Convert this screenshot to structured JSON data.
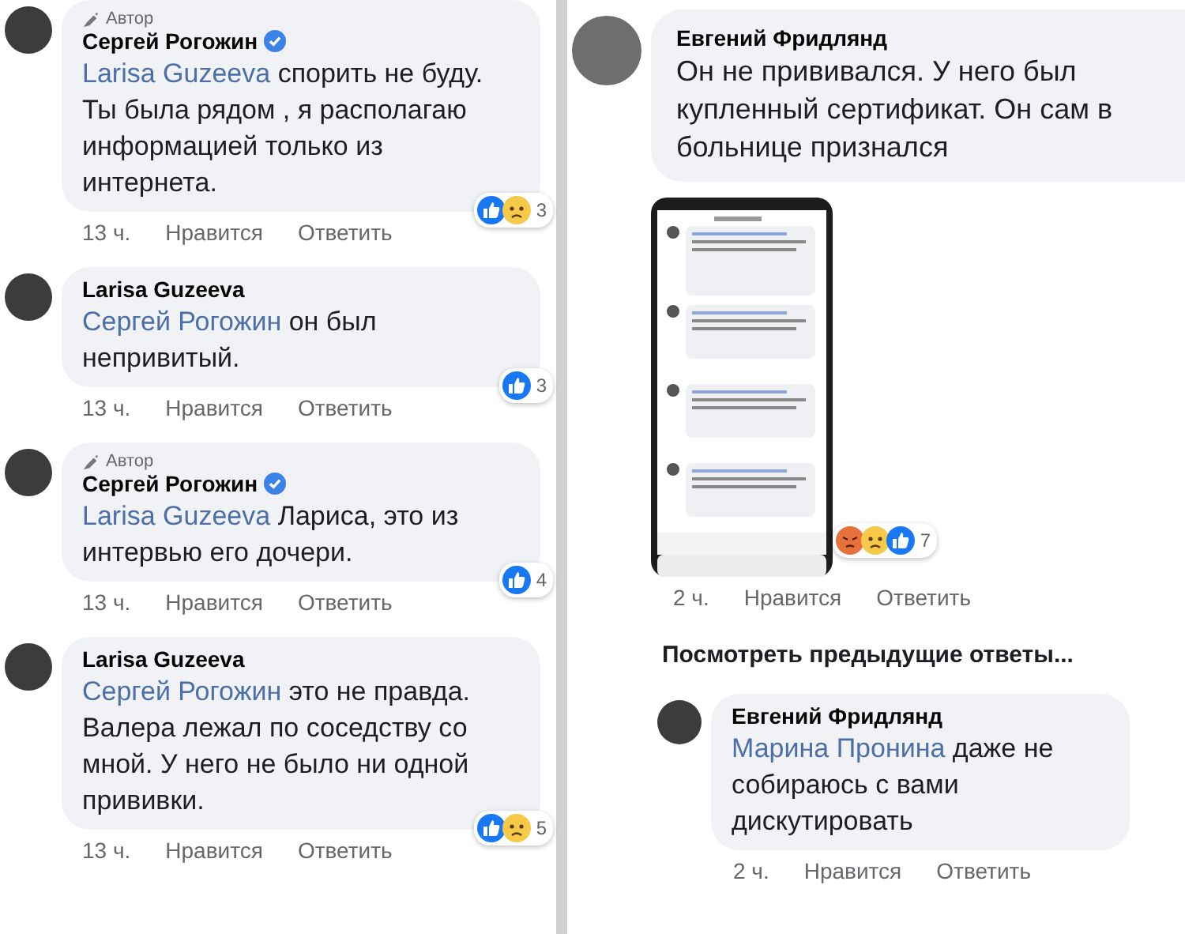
{
  "left_column": {
    "comments": [
      {
        "author_badge": "Автор",
        "name": "Сергей Рогожин",
        "verified": true,
        "mention": "Larisa Guzeeva",
        "text": "спорить не буду. Ты была рядом , я располагаю информацией только из интернета.",
        "time": "13 ч.",
        "like": "Нравится",
        "reply": "Ответить",
        "reactions": [
          {
            "kind": "like"
          },
          {
            "kind": "sad"
          }
        ],
        "reaction_count": "3"
      },
      {
        "name": "Larisa Guzeeva",
        "mention": "Сергей Рогожин",
        "text": "он был непривитый.",
        "time": "13 ч.",
        "like": "Нравится",
        "reply": "Ответить",
        "reactions": [
          {
            "kind": "like"
          }
        ],
        "reaction_count": "3"
      },
      {
        "author_badge": "Автор",
        "name": "Сергей Рогожин",
        "verified": true,
        "mention": "Larisa Guzeeva",
        "text": "Лариса, это из интервью его дочери.",
        "time": "13 ч.",
        "like": "Нравится",
        "reply": "Ответить",
        "reactions": [
          {
            "kind": "like"
          }
        ],
        "reaction_count": "4"
      },
      {
        "name": "Larisa Guzeeva",
        "mention": "Сергей Рогожин",
        "text": "это не правда. Валера лежал по соседству со мной. У него не было ни одной прививки.",
        "time": "13 ч.",
        "like": "Нравится",
        "reply": "Ответить",
        "reactions": [
          {
            "kind": "like"
          },
          {
            "kind": "sad"
          }
        ],
        "reaction_count": "5"
      }
    ]
  },
  "right_column": {
    "comment": {
      "name": "Евгений Фридлянд",
      "text": "Он не прививался. У него был купленный сертификат. Он сам в больнице признался",
      "attachment": {
        "kind": "screenshot"
      },
      "time": "2 ч.",
      "like": "Нравится",
      "reply": "Ответить",
      "reactions": [
        {
          "kind": "angry"
        },
        {
          "kind": "sad"
        },
        {
          "kind": "like"
        }
      ],
      "reaction_count": "7"
    },
    "view_previous": "Посмотреть предыдущие ответы...",
    "replies": [
      {
        "name": "Евгений Фридлянд",
        "mention": "Марина Пронина",
        "text": "даже не собираюсь с вами дискутировать",
        "time": "2 ч.",
        "like": "Нравится",
        "reply": "Ответить"
      }
    ]
  }
}
